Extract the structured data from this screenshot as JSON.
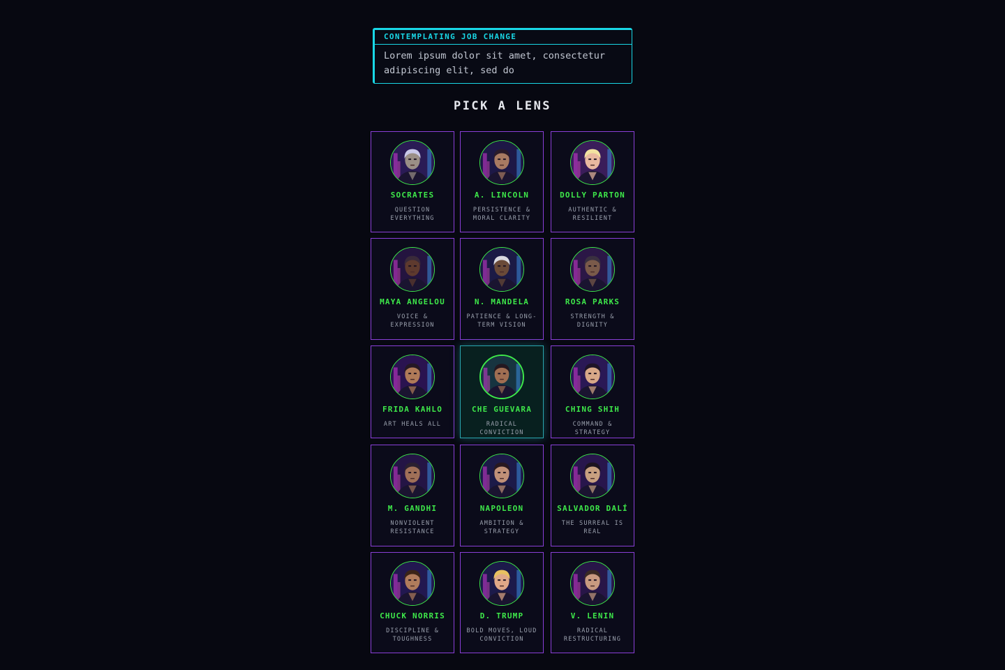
{
  "note": {
    "title": "CONTEMPLATING JOB CHANGE",
    "body": "Lorem ipsum dolor sit amet, consectetur adipiscing elit, sed do"
  },
  "section_title": "PICK A LENS",
  "colors": {
    "background": "#070811",
    "accent_cyan": "#19d7e6",
    "card_border": "#8a3fd8",
    "name_green": "#3ee84a",
    "selected_bg": "#08201f"
  },
  "lenses": [
    {
      "name": "SOCRATES",
      "tagline": "QUESTION EVERYTHING",
      "icon": "socrates-avatar",
      "selected": false
    },
    {
      "name": "A. LINCOLN",
      "tagline": "PERSISTENCE & MORAL CLARITY",
      "icon": "lincoln-avatar",
      "selected": false
    },
    {
      "name": "DOLLY PARTON",
      "tagline": "AUTHENTIC & RESILIENT",
      "icon": "dolly-parton-avatar",
      "selected": false
    },
    {
      "name": "MAYA ANGELOU",
      "tagline": "VOICE & EXPRESSION",
      "icon": "maya-angelou-avatar",
      "selected": false
    },
    {
      "name": "N. MANDELA",
      "tagline": "PATIENCE & LONG-TERM VISION",
      "icon": "mandela-avatar",
      "selected": false
    },
    {
      "name": "ROSA PARKS",
      "tagline": "STRENGTH & DIGNITY",
      "icon": "rosa-parks-avatar",
      "selected": false
    },
    {
      "name": "FRIDA KAHLO",
      "tagline": "ART HEALS ALL",
      "icon": "frida-kahlo-avatar",
      "selected": false
    },
    {
      "name": "CHE GUEVARA",
      "tagline": "RADICAL CONVICTION",
      "icon": "che-guevara-avatar",
      "selected": true
    },
    {
      "name": "CHING SHIH",
      "tagline": "COMMAND & STRATEGY",
      "icon": "ching-shih-avatar",
      "selected": false
    },
    {
      "name": "M. GANDHI",
      "tagline": "NONVIOLENT RESISTANCE",
      "icon": "gandhi-avatar",
      "selected": false
    },
    {
      "name": "NAPOLEON",
      "tagline": "AMBITION & STRATEGY",
      "icon": "napoleon-avatar",
      "selected": false
    },
    {
      "name": "SALVADOR DALÍ",
      "tagline": "THE SURREAL IS REAL",
      "icon": "dali-avatar",
      "selected": false
    },
    {
      "name": "CHUCK NORRIS",
      "tagline": "DISCIPLINE & TOUGHNESS",
      "icon": "chuck-norris-avatar",
      "selected": false
    },
    {
      "name": "D. TRUMP",
      "tagline": "BOLD MOVES, LOUD CONVICTION",
      "icon": "trump-avatar",
      "selected": false
    },
    {
      "name": "V. LENIN",
      "tagline": "RADICAL RESTRUCTURING",
      "icon": "lenin-avatar",
      "selected": false
    }
  ]
}
